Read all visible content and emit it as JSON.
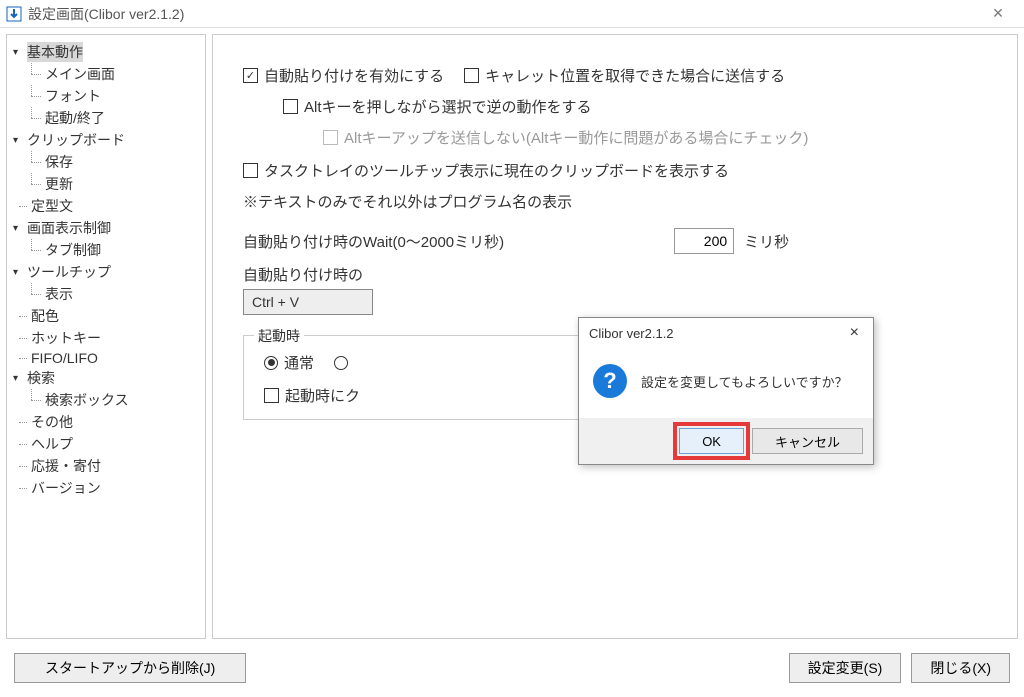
{
  "window": {
    "title": "設定画面(Clibor ver2.1.2)"
  },
  "sidebar": {
    "groups": [
      {
        "label": "基本動作",
        "children": [
          "メイン画面",
          "フォント",
          "起動/終了"
        ]
      },
      {
        "label": "クリップボード",
        "children": [
          "保存",
          "更新"
        ]
      },
      {
        "label": "定型文",
        "children": []
      },
      {
        "label": "画面表示制御",
        "children": [
          "タブ制御"
        ]
      },
      {
        "label": "ツールチップ",
        "children": [
          "表示"
        ]
      },
      {
        "label": "配色",
        "children": []
      },
      {
        "label": "ホットキー",
        "children": []
      },
      {
        "label": "FIFO/LIFO",
        "children": []
      },
      {
        "label": "検索",
        "children": [
          "検索ボックス"
        ]
      },
      {
        "label": "その他",
        "children": []
      },
      {
        "label": "ヘルプ",
        "children": []
      },
      {
        "label": "応援・寄付",
        "children": []
      },
      {
        "label": "バージョン",
        "children": []
      }
    ],
    "selected": "基本動作"
  },
  "settings": {
    "auto_paste_enable": "自動貼り付けを有効にする",
    "caret_send": "キャレット位置を取得できた場合に送信する",
    "alt_reverse": "Altキーを押しながら選択で逆の動作をする",
    "alt_up_nosend": "Altキーアップを送信しない(Altキー動作に問題がある場合にチェック)",
    "tray_tooltip": "タスクトレイのツールチップ表示に現在のクリップボードを表示する",
    "tray_note": "※テキストのみでそれ以外はプログラム名の表示",
    "wait_label": "自動貼り付け時のWait(0～2000ミリ秒)",
    "wait_value": "200",
    "wait_unit": "ミリ秒",
    "method_label": "自動貼り付け時の",
    "method_value": "Ctrl + V",
    "startup_legend": "起動時",
    "radio_normal": "通常",
    "startup_clear": "起動時にク"
  },
  "dialog": {
    "title": "Clibor ver2.1.2",
    "message": "設定を変更してもよろしいですか？",
    "ok": "OK",
    "cancel": "キャンセル"
  },
  "footer": {
    "startup_remove": "スタートアップから削除(J)",
    "apply": "設定変更(S)",
    "close": "閉じる(X)"
  }
}
